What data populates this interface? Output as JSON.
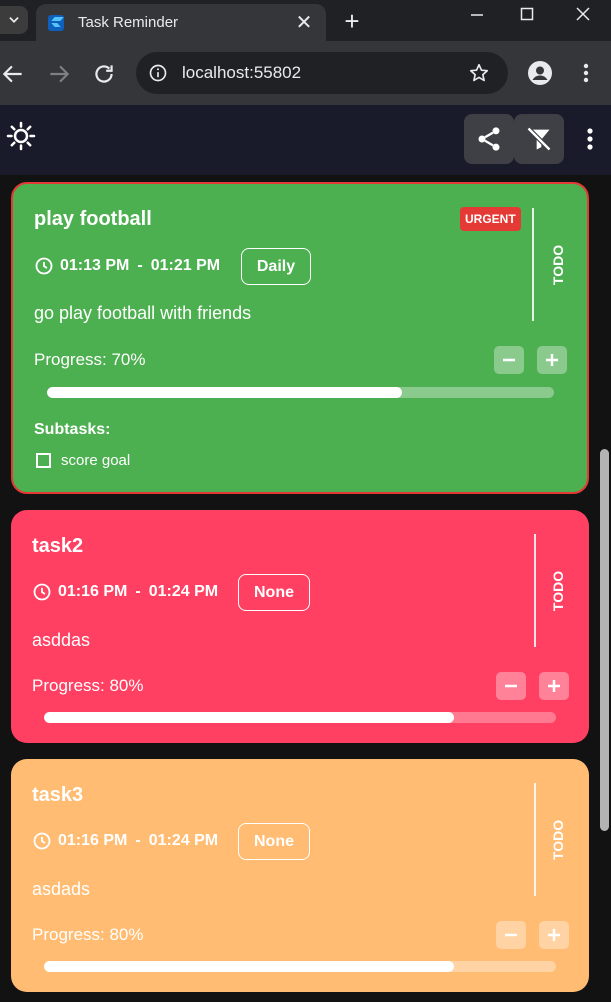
{
  "browser": {
    "tab_title": "Task Reminder",
    "url": "localhost:55802",
    "new_tab_symbol": "+",
    "close_symbol": "✕",
    "minimize_symbol": "—",
    "maximize_symbol": "☐",
    "window_close_symbol": "✕"
  },
  "appbar": {
    "theme_icon": "sun-icon",
    "share_icon": "share-icon",
    "filter_icon": "filter-off-icon",
    "more_icon": "more-vert-icon"
  },
  "tasks": [
    {
      "title": "play football",
      "start": "01:13 PM",
      "end": "01:21 PM",
      "dash": "-",
      "repeat": "Daily",
      "description": "go play football with friends",
      "progress_label": "Progress: 70%",
      "progress": 0.7,
      "status": "TODO",
      "badge": "URGENT",
      "subtasks_label": "Subtasks:",
      "subtasks": [
        "score goal"
      ],
      "color": "#4caf50",
      "border_color": "#e53935"
    },
    {
      "title": "task2",
      "start": "01:16 PM",
      "end": "01:24 PM",
      "dash": "-",
      "repeat": "None",
      "description": "asddas",
      "progress_label": "Progress: 80%",
      "progress": 0.8,
      "status": "TODO",
      "color": "#ff4062"
    },
    {
      "title": "task3",
      "start": "01:16 PM",
      "end": "01:24 PM",
      "dash": "-",
      "repeat": "None",
      "description": "asdads",
      "progress_label": "Progress: 80%",
      "progress": 0.8,
      "status": "TODO",
      "color": "#ffbc72"
    }
  ]
}
